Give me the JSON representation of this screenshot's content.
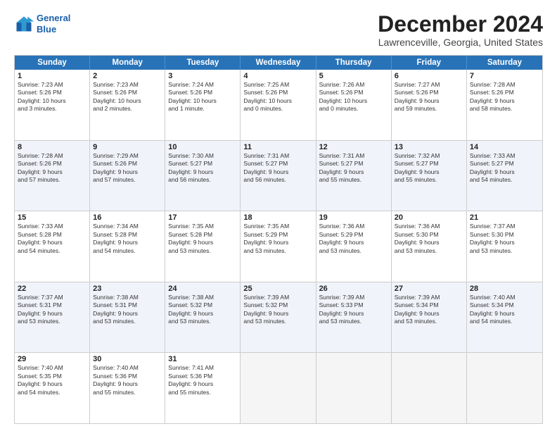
{
  "header": {
    "logo_line1": "General",
    "logo_line2": "Blue",
    "month": "December 2024",
    "location": "Lawrenceville, Georgia, United States"
  },
  "days_of_week": [
    "Sunday",
    "Monday",
    "Tuesday",
    "Wednesday",
    "Thursday",
    "Friday",
    "Saturday"
  ],
  "rows": [
    {
      "alt": false,
      "cells": [
        {
          "day": "1",
          "lines": [
            "Sunrise: 7:23 AM",
            "Sunset: 5:26 PM",
            "Daylight: 10 hours",
            "and 3 minutes."
          ]
        },
        {
          "day": "2",
          "lines": [
            "Sunrise: 7:23 AM",
            "Sunset: 5:26 PM",
            "Daylight: 10 hours",
            "and 2 minutes."
          ]
        },
        {
          "day": "3",
          "lines": [
            "Sunrise: 7:24 AM",
            "Sunset: 5:26 PM",
            "Daylight: 10 hours",
            "and 1 minute."
          ]
        },
        {
          "day": "4",
          "lines": [
            "Sunrise: 7:25 AM",
            "Sunset: 5:26 PM",
            "Daylight: 10 hours",
            "and 0 minutes."
          ]
        },
        {
          "day": "5",
          "lines": [
            "Sunrise: 7:26 AM",
            "Sunset: 5:26 PM",
            "Daylight: 10 hours",
            "and 0 minutes."
          ]
        },
        {
          "day": "6",
          "lines": [
            "Sunrise: 7:27 AM",
            "Sunset: 5:26 PM",
            "Daylight: 9 hours",
            "and 59 minutes."
          ]
        },
        {
          "day": "7",
          "lines": [
            "Sunrise: 7:28 AM",
            "Sunset: 5:26 PM",
            "Daylight: 9 hours",
            "and 58 minutes."
          ]
        }
      ]
    },
    {
      "alt": true,
      "cells": [
        {
          "day": "8",
          "lines": [
            "Sunrise: 7:28 AM",
            "Sunset: 5:26 PM",
            "Daylight: 9 hours",
            "and 57 minutes."
          ]
        },
        {
          "day": "9",
          "lines": [
            "Sunrise: 7:29 AM",
            "Sunset: 5:26 PM",
            "Daylight: 9 hours",
            "and 57 minutes."
          ]
        },
        {
          "day": "10",
          "lines": [
            "Sunrise: 7:30 AM",
            "Sunset: 5:27 PM",
            "Daylight: 9 hours",
            "and 56 minutes."
          ]
        },
        {
          "day": "11",
          "lines": [
            "Sunrise: 7:31 AM",
            "Sunset: 5:27 PM",
            "Daylight: 9 hours",
            "and 56 minutes."
          ]
        },
        {
          "day": "12",
          "lines": [
            "Sunrise: 7:31 AM",
            "Sunset: 5:27 PM",
            "Daylight: 9 hours",
            "and 55 minutes."
          ]
        },
        {
          "day": "13",
          "lines": [
            "Sunrise: 7:32 AM",
            "Sunset: 5:27 PM",
            "Daylight: 9 hours",
            "and 55 minutes."
          ]
        },
        {
          "day": "14",
          "lines": [
            "Sunrise: 7:33 AM",
            "Sunset: 5:27 PM",
            "Daylight: 9 hours",
            "and 54 minutes."
          ]
        }
      ]
    },
    {
      "alt": false,
      "cells": [
        {
          "day": "15",
          "lines": [
            "Sunrise: 7:33 AM",
            "Sunset: 5:28 PM",
            "Daylight: 9 hours",
            "and 54 minutes."
          ]
        },
        {
          "day": "16",
          "lines": [
            "Sunrise: 7:34 AM",
            "Sunset: 5:28 PM",
            "Daylight: 9 hours",
            "and 54 minutes."
          ]
        },
        {
          "day": "17",
          "lines": [
            "Sunrise: 7:35 AM",
            "Sunset: 5:28 PM",
            "Daylight: 9 hours",
            "and 53 minutes."
          ]
        },
        {
          "day": "18",
          "lines": [
            "Sunrise: 7:35 AM",
            "Sunset: 5:29 PM",
            "Daylight: 9 hours",
            "and 53 minutes."
          ]
        },
        {
          "day": "19",
          "lines": [
            "Sunrise: 7:36 AM",
            "Sunset: 5:29 PM",
            "Daylight: 9 hours",
            "and 53 minutes."
          ]
        },
        {
          "day": "20",
          "lines": [
            "Sunrise: 7:36 AM",
            "Sunset: 5:30 PM",
            "Daylight: 9 hours",
            "and 53 minutes."
          ]
        },
        {
          "day": "21",
          "lines": [
            "Sunrise: 7:37 AM",
            "Sunset: 5:30 PM",
            "Daylight: 9 hours",
            "and 53 minutes."
          ]
        }
      ]
    },
    {
      "alt": true,
      "cells": [
        {
          "day": "22",
          "lines": [
            "Sunrise: 7:37 AM",
            "Sunset: 5:31 PM",
            "Daylight: 9 hours",
            "and 53 minutes."
          ]
        },
        {
          "day": "23",
          "lines": [
            "Sunrise: 7:38 AM",
            "Sunset: 5:31 PM",
            "Daylight: 9 hours",
            "and 53 minutes."
          ]
        },
        {
          "day": "24",
          "lines": [
            "Sunrise: 7:38 AM",
            "Sunset: 5:32 PM",
            "Daylight: 9 hours",
            "and 53 minutes."
          ]
        },
        {
          "day": "25",
          "lines": [
            "Sunrise: 7:39 AM",
            "Sunset: 5:32 PM",
            "Daylight: 9 hours",
            "and 53 minutes."
          ]
        },
        {
          "day": "26",
          "lines": [
            "Sunrise: 7:39 AM",
            "Sunset: 5:33 PM",
            "Daylight: 9 hours",
            "and 53 minutes."
          ]
        },
        {
          "day": "27",
          "lines": [
            "Sunrise: 7:39 AM",
            "Sunset: 5:34 PM",
            "Daylight: 9 hours",
            "and 53 minutes."
          ]
        },
        {
          "day": "28",
          "lines": [
            "Sunrise: 7:40 AM",
            "Sunset: 5:34 PM",
            "Daylight: 9 hours",
            "and 54 minutes."
          ]
        }
      ]
    },
    {
      "alt": false,
      "cells": [
        {
          "day": "29",
          "lines": [
            "Sunrise: 7:40 AM",
            "Sunset: 5:35 PM",
            "Daylight: 9 hours",
            "and 54 minutes."
          ]
        },
        {
          "day": "30",
          "lines": [
            "Sunrise: 7:40 AM",
            "Sunset: 5:36 PM",
            "Daylight: 9 hours",
            "and 55 minutes."
          ]
        },
        {
          "day": "31",
          "lines": [
            "Sunrise: 7:41 AM",
            "Sunset: 5:36 PM",
            "Daylight: 9 hours",
            "and 55 minutes."
          ]
        },
        {
          "day": "",
          "lines": []
        },
        {
          "day": "",
          "lines": []
        },
        {
          "day": "",
          "lines": []
        },
        {
          "day": "",
          "lines": []
        }
      ]
    }
  ]
}
